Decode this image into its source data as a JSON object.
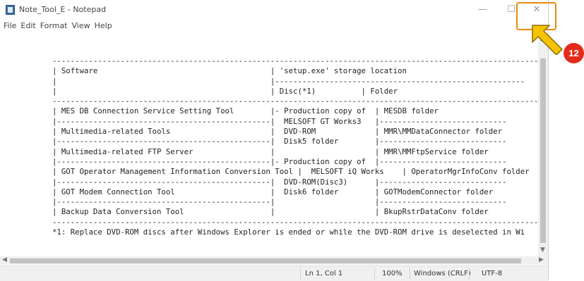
{
  "window": {
    "title": "Note_Tool_E - Notepad"
  },
  "titlebar_buttons": {
    "minimize": "—",
    "maximize": "☐",
    "close": "✕"
  },
  "menu": [
    "File",
    "Edit",
    "Format",
    "View",
    "Help"
  ],
  "content": {
    "lines": [
      "------------------------------------------------------------------------------------------------------------",
      "| Software                                      | 'setup.exe' storage location",
      "|                                               |-------------------------------------------------------",
      "|                                               | Disc(*1)          | Folder",
      "------------------------------------------------------------------------------------------------------------",
      "| MES DB Connection Service Setting Tool        |- Production copy of  | MESDB folder",
      "|-----------------------------------------------|  MELSOFT GT Works3   |----------------------------",
      "| Multimedia-related Tools                      |  DVD-ROM             | MMR\\MMDataConnector folder",
      "|-----------------------------------------------|  Disk5 folder        |----------------------------",
      "| Multimedia-related FTP Server                 |                      | MMR\\MMFtpService folder",
      "|-----------------------------------------------|- Production copy of  |----------------------------",
      "| GOT Operator Management Information Conversion Tool |  MELSOFT iQ Works    | OperatorMgrInfoConv folder",
      "|-----------------------------------------------|  DVD-ROM(Disc3)      |----------------------------",
      "| GOT Modem Connection Tool                     |  Disk6 folder        | GOTModemConnector folder",
      "|-----------------------------------------------|                      |----------------------------",
      "| Backup Data Conversion Tool                   |                      | BkupRstrDataConv folder",
      "------------------------------------------------------------------------------------------------------------",
      "*1: Replace DVD-ROM discs after Windows Explorer is ended or while the DVD-ROM drive is deselected in Wi"
    ]
  },
  "status": {
    "position": "Ln 1, Col 1",
    "zoom": "100%",
    "line_ending": "Windows (CRLF)",
    "encoding": "UTF-8"
  },
  "callout": {
    "number": "12",
    "color": "#e32b1b",
    "highlight_color": "#e8890b",
    "arrow_color": "#f5c400"
  }
}
